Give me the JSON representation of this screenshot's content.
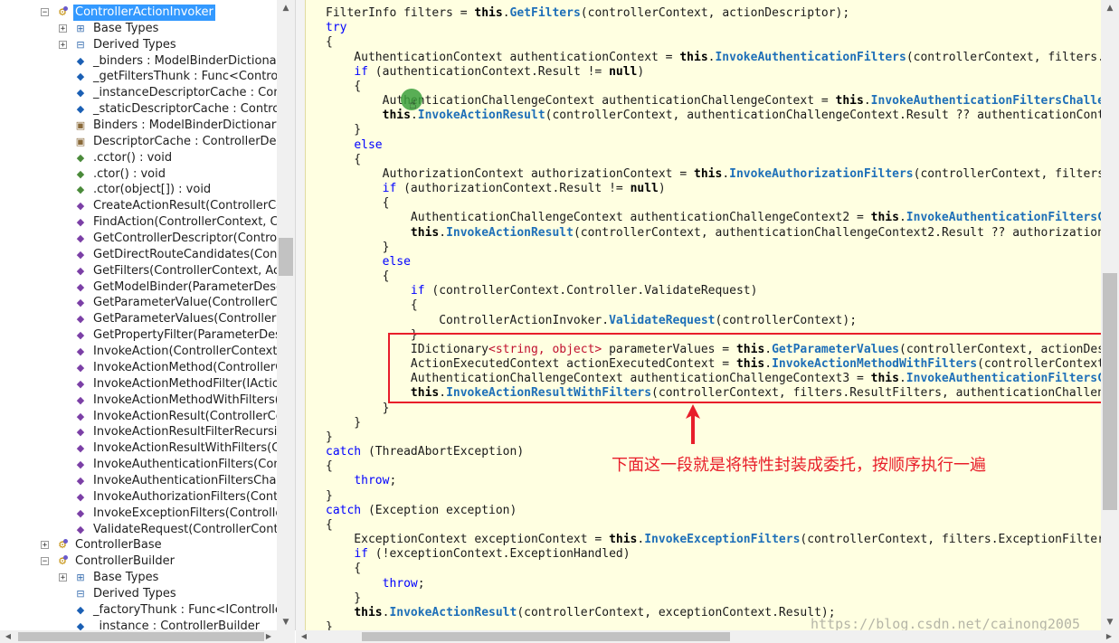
{
  "tree": {
    "items": [
      {
        "label": "ControllerActionInvoker",
        "icon": "class-icon",
        "selected": true
      },
      {
        "label": "Base Types",
        "icon": "base-types-icon"
      },
      {
        "label": "Derived Types",
        "icon": "derived-types-icon"
      },
      {
        "label": "_binders : ModelBinderDictionary",
        "icon": "field-icon"
      },
      {
        "label": "_getFiltersThunk : Func<ControllerContext",
        "icon": "field-icon"
      },
      {
        "label": "_instanceDescriptorCache : ControllerDescriptorCache",
        "icon": "field-icon"
      },
      {
        "label": "_staticDescriptorCache : ControllerDescriptorCache",
        "icon": "field-icon"
      },
      {
        "label": "Binders : ModelBinderDictionary",
        "icon": "property-icon"
      },
      {
        "label": "DescriptorCache : ControllerDescriptorCache",
        "icon": "property-icon"
      },
      {
        "label": ".cctor() : void",
        "icon": "constructor-icon"
      },
      {
        "label": ".ctor() : void",
        "icon": "constructor-icon"
      },
      {
        "label": ".ctor(object[]) : void",
        "icon": "constructor-icon"
      },
      {
        "label": "CreateActionResult(ControllerContext",
        "icon": "method-icon"
      },
      {
        "label": "FindAction(ControllerContext, ControllerDescriptor",
        "icon": "method-icon"
      },
      {
        "label": "GetControllerDescriptor(ControllerContext",
        "icon": "method-icon"
      },
      {
        "label": "GetDirectRouteCandidates(ControllerContext",
        "icon": "method-icon"
      },
      {
        "label": "GetFilters(ControllerContext, ActionDescriptor",
        "icon": "method-icon"
      },
      {
        "label": "GetModelBinder(ParameterDescriptor",
        "icon": "method-icon"
      },
      {
        "label": "GetParameterValue(ControllerContext",
        "icon": "method-icon"
      },
      {
        "label": "GetParameterValues(ControllerContext",
        "icon": "method-icon"
      },
      {
        "label": "GetPropertyFilter(ParameterDescriptor",
        "icon": "method-icon"
      },
      {
        "label": "InvokeAction(ControllerContext, string",
        "icon": "method-icon"
      },
      {
        "label": "InvokeActionMethod(ControllerContext",
        "icon": "method-icon"
      },
      {
        "label": "InvokeActionMethodFilter(IActionFilter",
        "icon": "method-icon"
      },
      {
        "label": "InvokeActionMethodWithFilters(ControllerContext",
        "icon": "method-icon"
      },
      {
        "label": "InvokeActionResult(ControllerContext",
        "icon": "method-icon"
      },
      {
        "label": "InvokeActionResultFilterRecursive",
        "icon": "method-icon"
      },
      {
        "label": "InvokeActionResultWithFilters(ControllerContext",
        "icon": "method-icon"
      },
      {
        "label": "InvokeAuthenticationFilters(ControllerContext",
        "icon": "method-icon"
      },
      {
        "label": "InvokeAuthenticationFiltersChallenge",
        "icon": "method-icon"
      },
      {
        "label": "InvokeAuthorizationFilters(ControllerContext",
        "icon": "method-icon"
      },
      {
        "label": "InvokeExceptionFilters(ControllerContext",
        "icon": "method-icon"
      },
      {
        "label": "ValidateRequest(ControllerContext)",
        "icon": "method-icon"
      },
      {
        "label": "ControllerBase",
        "icon": "class-icon"
      },
      {
        "label": "ControllerBuilder",
        "icon": "class-icon"
      },
      {
        "label": "Base Types",
        "icon": "base-types-icon"
      },
      {
        "label": "Derived Types",
        "icon": "derived-types-icon"
      },
      {
        "label": "_factoryThunk : Func<IControllerFactory>",
        "icon": "field-icon"
      },
      {
        "label": "_instance : ControllerBuilder",
        "icon": "field-icon"
      }
    ]
  },
  "code": {
    "lines": [
      [
        [
          "t",
          "FilterInfo filters = "
        ],
        [
          "b",
          "this"
        ],
        [
          "t",
          "."
        ],
        [
          "m",
          "GetFilters"
        ],
        [
          "t",
          "(controllerContext, actionDescriptor);"
        ]
      ],
      [
        [
          "k",
          "try"
        ]
      ],
      [
        [
          "t",
          "{"
        ]
      ],
      [
        [
          "t",
          "    AuthenticationContext authenticationContext = "
        ],
        [
          "b",
          "this"
        ],
        [
          "t",
          "."
        ],
        [
          "m",
          "InvokeAuthenticationFilters"
        ],
        [
          "t",
          "(controllerContext, filters.AuthenticationFilters, actionDescriptor);"
        ]
      ],
      [
        [
          "t",
          "    "
        ],
        [
          "k",
          "if"
        ],
        [
          "t",
          " (authenticationContext.Result != "
        ],
        [
          "b",
          "null"
        ],
        [
          "t",
          ")"
        ]
      ],
      [
        [
          "t",
          "    {"
        ]
      ],
      [
        [
          "t",
          "        AuthenticationChallengeContext authenticationChallengeContext = "
        ],
        [
          "b",
          "this"
        ],
        [
          "t",
          "."
        ],
        [
          "m",
          "InvokeAuthenticationFiltersChallenge"
        ],
        [
          "t",
          "(controllerContext, filters.AuthenticationFilters, actionDescriptor, authenticationContext.Result);"
        ]
      ],
      [
        [
          "t",
          "        "
        ],
        [
          "b",
          "this"
        ],
        [
          "t",
          "."
        ],
        [
          "m",
          "InvokeActionResult"
        ],
        [
          "t",
          "(controllerContext, authenticationChallengeContext.Result ?? authenticationContext.Result);"
        ]
      ],
      [
        [
          "t",
          "    }"
        ]
      ],
      [
        [
          "t",
          "    "
        ],
        [
          "k",
          "else"
        ]
      ],
      [
        [
          "t",
          "    {"
        ]
      ],
      [
        [
          "t",
          "        AuthorizationContext authorizationContext = "
        ],
        [
          "b",
          "this"
        ],
        [
          "t",
          "."
        ],
        [
          "m",
          "InvokeAuthorizationFilters"
        ],
        [
          "t",
          "(controllerContext, filters.AuthorizationFilters, actionDescriptor);"
        ]
      ],
      [
        [
          "t",
          "        "
        ],
        [
          "k",
          "if"
        ],
        [
          "t",
          " (authorizationContext.Result != "
        ],
        [
          "b",
          "null"
        ],
        [
          "t",
          ")"
        ]
      ],
      [
        [
          "t",
          "        {"
        ]
      ],
      [
        [
          "t",
          "            AuthenticationChallengeContext authenticationChallengeContext2 = "
        ],
        [
          "b",
          "this"
        ],
        [
          "t",
          "."
        ],
        [
          "m",
          "InvokeAuthenticationFiltersChallenge"
        ],
        [
          "t",
          "(controllerContext, filters.AuthenticationFilters, actionDescriptor, authorizationContext.Result);"
        ]
      ],
      [
        [
          "t",
          "            "
        ],
        [
          "b",
          "this"
        ],
        [
          "t",
          "."
        ],
        [
          "m",
          "InvokeActionResult"
        ],
        [
          "t",
          "(controllerContext, authenticationChallengeContext2.Result ?? authorizationContext.Result);"
        ]
      ],
      [
        [
          "t",
          "        }"
        ]
      ],
      [
        [
          "t",
          "        "
        ],
        [
          "k",
          "else"
        ]
      ],
      [
        [
          "t",
          "        {"
        ]
      ],
      [
        [
          "t",
          "            "
        ],
        [
          "k",
          "if"
        ],
        [
          "t",
          " (controllerContext.Controller.ValidateRequest)"
        ]
      ],
      [
        [
          "t",
          "            {"
        ]
      ],
      [
        [
          "t",
          "                ControllerActionInvoker."
        ],
        [
          "m",
          "ValidateRequest"
        ],
        [
          "t",
          "(controllerContext);"
        ]
      ],
      [
        [
          "t",
          "            }"
        ]
      ],
      [
        [
          "t",
          "            IDictionary"
        ],
        [
          "r",
          "<string, object>"
        ],
        [
          "t",
          " parameterValues = "
        ],
        [
          "b",
          "this"
        ],
        [
          "t",
          "."
        ],
        [
          "m",
          "GetParameterValues"
        ],
        [
          "t",
          "(controllerContext, actionDescriptor);"
        ]
      ],
      [
        [
          "t",
          "            ActionExecutedContext actionExecutedContext = "
        ],
        [
          "b",
          "this"
        ],
        [
          "t",
          "."
        ],
        [
          "m",
          "InvokeActionMethodWithFilters"
        ],
        [
          "t",
          "(controllerContext, filters.ActionFilters, actionDescriptor, parameterValues);"
        ]
      ],
      [
        [
          "t",
          "            AuthenticationChallengeContext authenticationChallengeContext3 = "
        ],
        [
          "b",
          "this"
        ],
        [
          "t",
          "."
        ],
        [
          "m",
          "InvokeAuthenticationFiltersChallenge"
        ],
        [
          "t",
          "(controllerContext, filters.AuthenticationFilters, actionDescriptor, actionExecutedContext.Result);"
        ]
      ],
      [
        [
          "t",
          "            "
        ],
        [
          "b",
          "this"
        ],
        [
          "t",
          "."
        ],
        [
          "m",
          "InvokeActionResultWithFilters"
        ],
        [
          "t",
          "(controllerContext, filters.ResultFilters, authenticationChallengeContext3.Result ?? actionExecutedContext.Result);"
        ]
      ],
      [
        [
          "t",
          "        }"
        ]
      ],
      [
        [
          "t",
          "    }"
        ]
      ],
      [
        [
          "t",
          "}"
        ]
      ],
      [
        [
          "k",
          "catch"
        ],
        [
          "t",
          " (ThreadAbortException)"
        ]
      ],
      [
        [
          "t",
          "{"
        ]
      ],
      [
        [
          "t",
          "    "
        ],
        [
          "k",
          "throw"
        ],
        [
          "t",
          ";"
        ]
      ],
      [
        [
          "t",
          "}"
        ]
      ],
      [
        [
          "k",
          "catch"
        ],
        [
          "t",
          " (Exception exception)"
        ]
      ],
      [
        [
          "t",
          "{"
        ]
      ],
      [
        [
          "t",
          "    ExceptionContext exceptionContext = "
        ],
        [
          "b",
          "this"
        ],
        [
          "t",
          "."
        ],
        [
          "m",
          "InvokeExceptionFilters"
        ],
        [
          "t",
          "(controllerContext, filters.ExceptionFilters, exception);"
        ]
      ],
      [
        [
          "t",
          "    "
        ],
        [
          "k",
          "if"
        ],
        [
          "t",
          " (!exceptionContext.ExceptionHandled)"
        ]
      ],
      [
        [
          "t",
          "    {"
        ]
      ],
      [
        [
          "t",
          "        "
        ],
        [
          "k",
          "throw"
        ],
        [
          "t",
          ";"
        ]
      ],
      [
        [
          "t",
          "    }"
        ]
      ],
      [
        [
          "t",
          "    "
        ],
        [
          "b",
          "this"
        ],
        [
          "t",
          "."
        ],
        [
          "m",
          "InvokeActionResult"
        ],
        [
          "t",
          "(controllerContext, exceptionContext.Result);"
        ]
      ],
      [
        [
          "t",
          "}"
        ]
      ]
    ]
  },
  "annotation": {
    "text": "下面这一段就是将特性封装成委托，按顺序执行一遍"
  },
  "watermark": "https://blog.csdn.net/cainong2005",
  "colors": {
    "selection": "#3399ff",
    "code_background": "#ffffe1",
    "keyword": "#0000ff",
    "method": "#1e6fb8",
    "generic_type": "#c0102e",
    "annotation": "#e81e2a"
  }
}
